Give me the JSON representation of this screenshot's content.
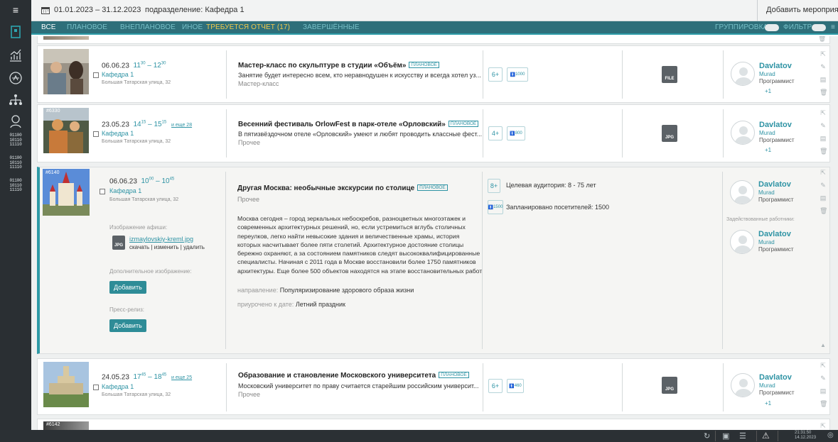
{
  "topbar": {
    "date_range": "01.01.2023 – 31.12.2023",
    "department": "подразделение: Кафедра 1",
    "add_event": "Добавить мероприятие"
  },
  "tabs": {
    "all": "ВСЕ",
    "planned": "ПЛАНОВОЕ",
    "unplanned": "ВНЕПЛАНОВОЕ",
    "other": "ИНОЕ",
    "report": "ТРЕБУЕТСЯ ОТЧЕТ (17)",
    "finished": "ЗАВЕРШЁННЫЕ",
    "grouping": "ГРУППИРОВКА",
    "filter": "ФИЛЬТР"
  },
  "sidebar": {
    "binary1": "01100\n10110\n11110",
    "binary2": "01100\n10110\n11110",
    "binary3": "01100\n10110\n11110"
  },
  "events": [
    {
      "date": "06.06.23",
      "t1": "11",
      "t1m": "30",
      "t2": "12",
      "t2m": "30",
      "dept": "Кафедра 1",
      "addr": "Большая Татарская улица, 32",
      "title": "Мастер-класс по скульптуре в студии «Объём»",
      "badge": "ПЛАНОВОЕ",
      "desc": "Занятие будет интересно всем, кто неравнодушен к искусству и всегда хотел уз...",
      "category": "Мастер-класс",
      "age": "6+",
      "visitors": "1000",
      "file": "FILE",
      "person_last": "Davlatov",
      "person_first": "Murad",
      "person_role": "Программист",
      "plus": "+1"
    },
    {
      "id": "#6330",
      "date": "23.05.23",
      "t1": "14",
      "t1m": "15",
      "t2": "15",
      "t2m": "15",
      "more": "и еще 28",
      "dept": "Кафедра 1",
      "addr": "Большая Татарская улица, 32",
      "title": "Весенний фестиваль OrlowFest в парк-отеле «Орловский»",
      "badge": "ПЛАНОВОЕ",
      "desc": "В пятизвёздочном отеле «Орловский» умеют и любят проводить классные фест...",
      "category": "Прочее",
      "age": "4+",
      "visitors": "800",
      "file": "JPG",
      "person_last": "Davlatov",
      "person_first": "Murad",
      "person_role": "Программист",
      "plus": "+1"
    },
    {
      "id": "#6140",
      "date": "06.06.23",
      "t1": "10",
      "t1m": "00",
      "t2": "10",
      "t2m": "45",
      "dept": "Кафедра 1",
      "addr": "Большая Татарская улица, 32",
      "title": "Другая Москва: необычные экскурсии по столице",
      "badge": "ПЛАНОВОЕ",
      "category": "Прочее",
      "poster_label": "Изображение афиши:",
      "poster_file": "izmaylovskiy-kreml.jpg",
      "poster_actions": "скачать | изменить | удалить",
      "extra_label": "Дополнительное изображение:",
      "add1": "Добавить",
      "press_label": "Пресс-релиз:",
      "add2": "Добавить",
      "para1": "Москва сегодня – город зеркальных небоскребов, разноцветных многоэтажек и",
      "para2": "современных архитектурных решений, но, если устремиться вглубь столичных",
      "para3": "переулков, легко найти невысокие здания и величественные храмы, история",
      "para4": "которых насчитывает более пяти столетий. Архитектурное достояние столицы",
      "para5": "бережно охраняют, а за состоянием памятников следят высококвалифицированные",
      "para6": "специалисты. Начиная с 2011 года в Москве восстановили более 1750 памятников",
      "para7": "архитектуры. Еще более 500 объектов находятся на этапе восстановительных работ.",
      "direction_label": "направление:",
      "direction": "Популяризирование здорового образа жизни",
      "timed_label": "приурочено к дате:",
      "timed": "Летний праздник",
      "age": "8+",
      "audience": "Целевая аудитория: 8 - 75 лет",
      "visitors": "1500",
      "planned": "Запланировано посетителей: 1500",
      "person_last": "Davlatov",
      "person_first": "Murad",
      "person_role": "Программист",
      "workers_label": "Задействованные работники:",
      "worker_last": "Davlatov",
      "worker_first": "Murad",
      "worker_role": "Программист"
    },
    {
      "date": "24.05.23",
      "t1": "17",
      "t1m": "45",
      "t2": "18",
      "t2m": "45",
      "more": "и еще 25",
      "dept": "Кафедра 1",
      "addr": "Большая Татарская улица, 32",
      "title": "Образование и становление Московского университета",
      "badge": "ПЛАНОВОЕ",
      "desc": "Московский университет по праву считается старейшим российским университ...",
      "category": "Прочее",
      "age": "6+",
      "visitors": "460",
      "file": "JPG",
      "person_last": "Davlatov",
      "person_first": "Murad",
      "person_role": "Программист",
      "plus": "+1"
    }
  ],
  "next_card_id": "#6142",
  "clock": {
    "time": "21:31:50",
    "date": "14.12.2023"
  }
}
